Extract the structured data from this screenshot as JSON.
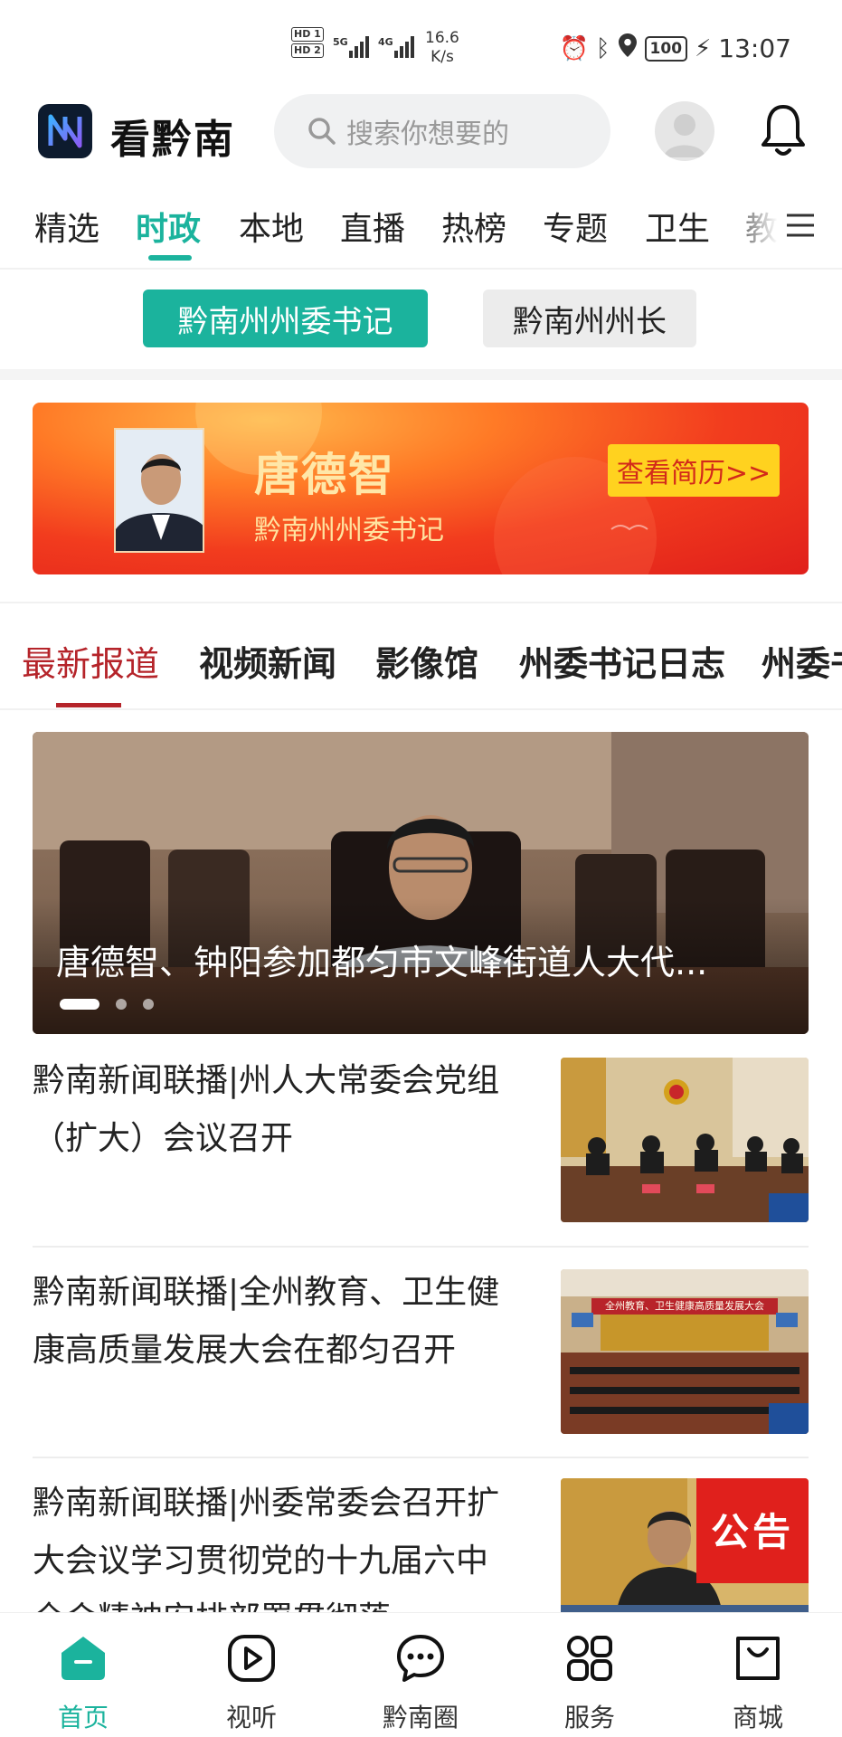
{
  "status_bar": {
    "hd1": "HD 1",
    "hd2": "HD 2",
    "net1": "5G",
    "net2": "4G",
    "speed_value": "16.6",
    "speed_unit": "K/s",
    "battery": "100",
    "time": "13:07"
  },
  "header": {
    "app_name": "看黔南",
    "search_placeholder": "搜索你想要的"
  },
  "channel_tabs": [
    "精选",
    "时政",
    "本地",
    "直播",
    "热榜",
    "专题",
    "卫生",
    "教"
  ],
  "sub_buttons": {
    "active": "黔南州州委书记",
    "inactive": "黔南州州长"
  },
  "banner": {
    "name": "唐德智",
    "title": "黔南州州委书记",
    "button": "查看简历>>"
  },
  "news_tabs": [
    "最新报道",
    "视频新闻",
    "影像馆",
    "州委书记日志",
    "州委书"
  ],
  "hero": {
    "caption": "唐德智、钟阳参加都匀市文峰街道人大代..."
  },
  "news": [
    {
      "title": "黔南新闻联播|州人大常委会党组（扩大）会议召开"
    },
    {
      "title": "黔南新闻联播|全州教育、卫生健康高质量发展大会在都匀召开",
      "thumb_banner": "全州教育、卫生健康高质量发展大会"
    },
    {
      "title": "黔南新闻联播|州委常委会召开扩大会议学习贯彻党的十九届六中全会精神安排部署贯彻落",
      "badge": "公告"
    }
  ],
  "bottom_nav": [
    {
      "label": "首页",
      "icon": "home-icon",
      "active": true
    },
    {
      "label": "视听",
      "icon": "play-icon"
    },
    {
      "label": "黔南圈",
      "icon": "chat-icon"
    },
    {
      "label": "服务",
      "icon": "grid-icon"
    },
    {
      "label": "商城",
      "icon": "shopping-bag-icon"
    }
  ],
  "colors": {
    "accent": "#1bb39d",
    "news_accent": "#b5242a",
    "banner_red": "#e01f1b",
    "banner_button": "#ffd21f"
  }
}
